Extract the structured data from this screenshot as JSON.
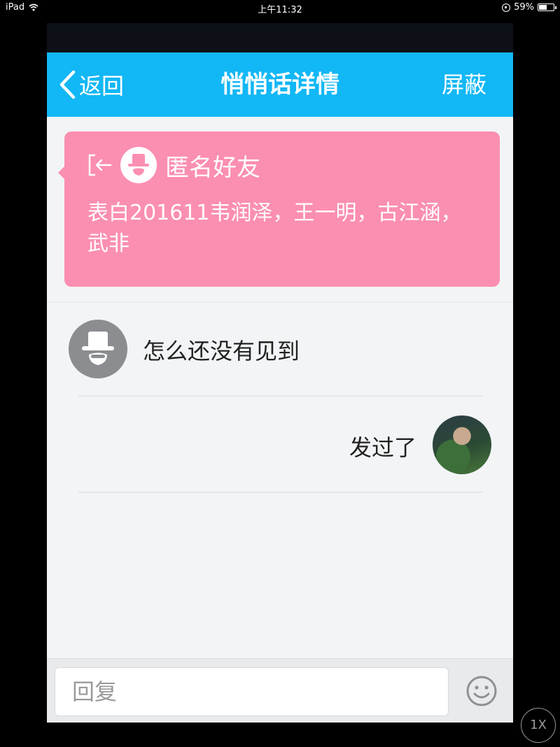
{
  "status_bar": {
    "device": "iPad",
    "time": "上午11:32",
    "battery_text": "59%",
    "battery_level": 0.59
  },
  "nav": {
    "back_label": "返回",
    "title": "悄悄话详情",
    "block_label": "屏蔽"
  },
  "card": {
    "sender": "匿名好友",
    "text": "表白201611韦润泽，王一明，古江涵，武非"
  },
  "messages": [
    {
      "side": "left",
      "text": "怎么还没有见到",
      "avatar": "anonymous-hat-icon"
    },
    {
      "side": "right",
      "text": "发过了",
      "avatar": "user-photo-avatar"
    }
  ],
  "reply": {
    "placeholder": "回复",
    "emoji_icon": "smiley-icon"
  },
  "zoom": {
    "label": "1X"
  },
  "colors": {
    "nav_blue": "#12b7f5",
    "card_pink": "#fb8fb1",
    "background": "#f2f4f6"
  }
}
